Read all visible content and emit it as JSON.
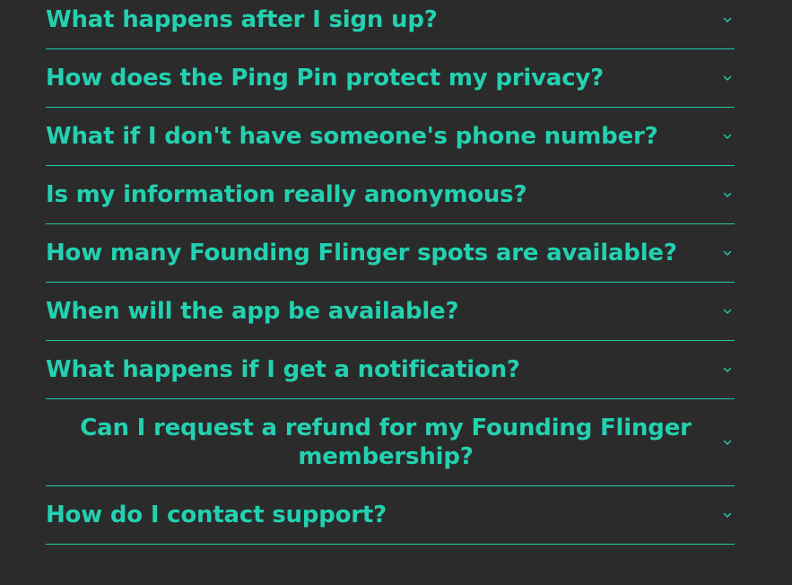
{
  "colors": {
    "background": "#2b2b2b",
    "accent": "#23d1b0",
    "divider": "#1fc9a8"
  },
  "faq": {
    "items": [
      {
        "question": "What happens after I sign up?",
        "icon": "chevron-down-icon"
      },
      {
        "question": "How does the Ping Pin protect my privacy?",
        "icon": "chevron-down-icon"
      },
      {
        "question": "What if I don't have someone's phone number?",
        "icon": "chevron-down-icon"
      },
      {
        "question": "Is my information really anonymous?",
        "icon": "chevron-down-icon"
      },
      {
        "question": "How many Founding Flinger spots are available?",
        "icon": "chevron-down-icon"
      },
      {
        "question": "When will the app be available?",
        "icon": "chevron-down-icon"
      },
      {
        "question": "What happens if I get a notification?",
        "icon": "chevron-down-icon"
      },
      {
        "question": "Can I request a refund for my Founding Flinger membership?",
        "icon": "chevron-down-icon"
      },
      {
        "question": "How do I contact support?",
        "icon": "chevron-down-icon"
      }
    ]
  }
}
